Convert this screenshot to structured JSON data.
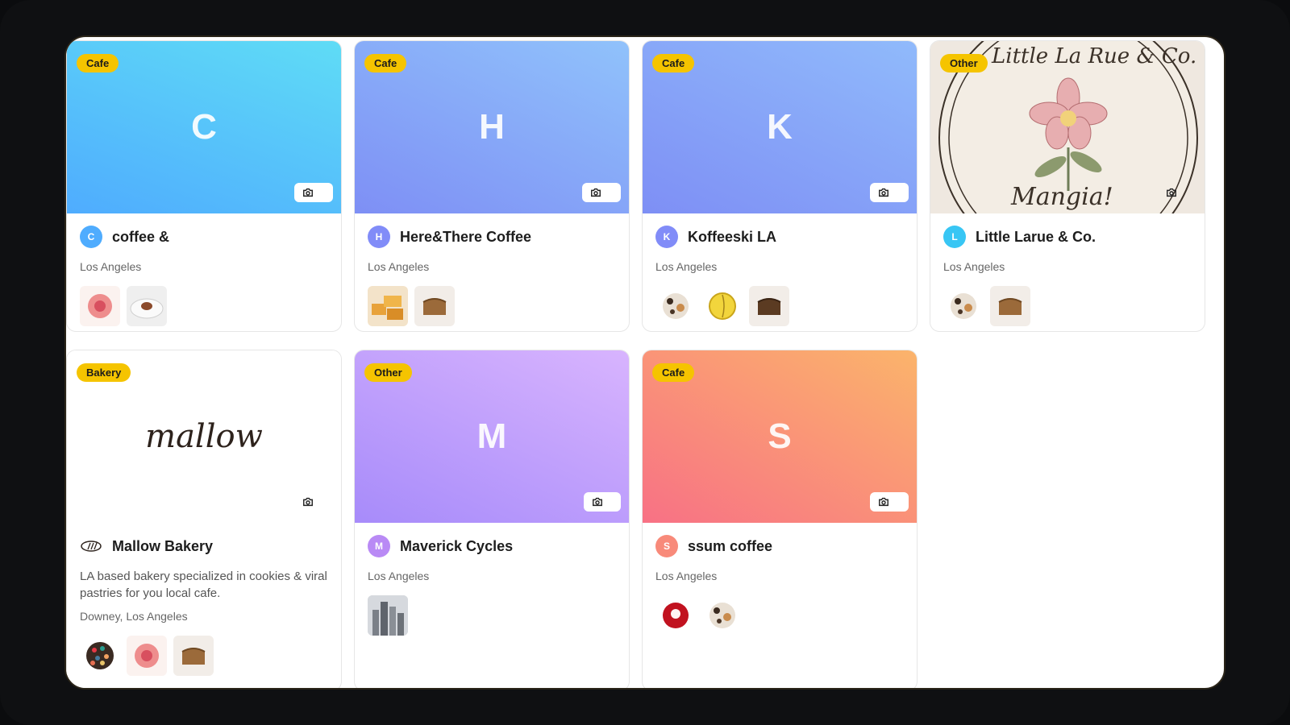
{
  "cards": [
    {
      "category": "Cafe",
      "letter": "C",
      "avatar_letter": "C",
      "name": "coffee &",
      "location": "Los Angeles",
      "thumbs": [
        "pink-donut",
        "dessert-plate"
      ]
    },
    {
      "category": "Cafe",
      "letter": "H",
      "avatar_letter": "H",
      "name": "Here&There Coffee",
      "location": "Los Angeles",
      "thumbs": [
        "cake-slices",
        "banana-bread"
      ]
    },
    {
      "category": "Cafe",
      "letter": "K",
      "avatar_letter": "K",
      "name": "Koffeeski LA",
      "location": "Los Angeles",
      "thumbs": [
        "cookie-donut",
        "lemon-donut",
        "chocolate-bread"
      ]
    },
    {
      "category": "Other",
      "logo_text_top": "Little La Rue & Co.",
      "logo_text_bottom": "Mangia!",
      "avatar_letter": "L",
      "name": "Little Larue & Co.",
      "location": "Los Angeles",
      "thumbs": [
        "cookie-donut",
        "banana-bread"
      ]
    },
    {
      "category": "Bakery",
      "logo_text": "mallow",
      "name": "Mallow Bakery",
      "description": "LA based bakery specialized in cookies & viral pastries for you local cafe.",
      "location": "Downey, Los Angeles",
      "thumbs": [
        "candy-cookie",
        "pink-donut",
        "banana-bread"
      ]
    },
    {
      "category": "Other",
      "letter": "M",
      "avatar_letter": "M",
      "name": "Maverick Cycles",
      "location": "Los Angeles",
      "thumbs": [
        "city-skyline"
      ]
    },
    {
      "category": "Cafe",
      "letter": "S",
      "avatar_letter": "S",
      "name": "ssum coffee",
      "location": "Los Angeles",
      "thumbs": [
        "red-velvet-donut",
        "cookie-donut"
      ]
    }
  ],
  "colors": {
    "badge": "#f5c400",
    "gradient_c": [
      "#4facfe",
      "#5fdcf6"
    ],
    "gradient_h": [
      "#7e8ff5",
      "#90c2fb"
    ],
    "gradient_k": [
      "#7e8ff5",
      "#90bafb"
    ],
    "gradient_m": [
      "#a78bfa",
      "#d8b4fe"
    ],
    "gradient_s": [
      "#f87185",
      "#fbb46b"
    ]
  }
}
